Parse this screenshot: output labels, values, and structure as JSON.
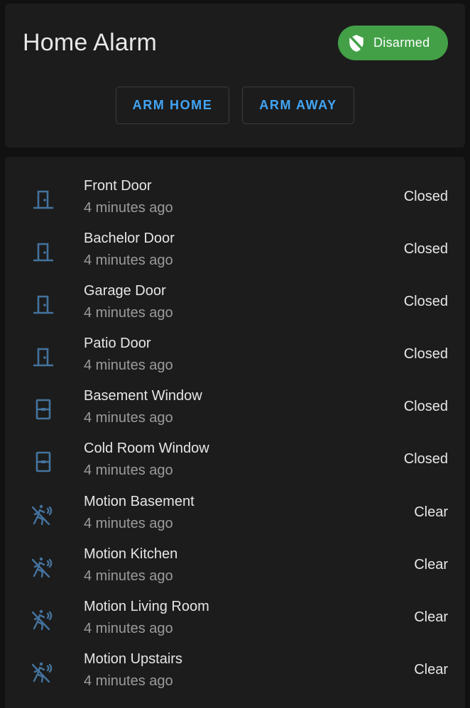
{
  "alarm": {
    "title": "Home Alarm",
    "status_label": "Disarmed",
    "status_icon": "shield-off-icon",
    "status_color": "#43a047",
    "arm_home_label": "ARM HOME",
    "arm_away_label": "ARM AWAY",
    "accent_color": "#42a5f5"
  },
  "entities": [
    {
      "name": "Front Door",
      "time": "4 minutes ago",
      "state": "Closed",
      "icon": "door-closed-icon"
    },
    {
      "name": "Bachelor Door",
      "time": "4 minutes ago",
      "state": "Closed",
      "icon": "door-closed-icon"
    },
    {
      "name": "Garage Door",
      "time": "4 minutes ago",
      "state": "Closed",
      "icon": "door-closed-icon"
    },
    {
      "name": "Patio Door",
      "time": "4 minutes ago",
      "state": "Closed",
      "icon": "door-closed-icon"
    },
    {
      "name": "Basement Window",
      "time": "4 minutes ago",
      "state": "Closed",
      "icon": "window-closed-icon"
    },
    {
      "name": "Cold Room Window",
      "time": "4 minutes ago",
      "state": "Closed",
      "icon": "window-closed-icon"
    },
    {
      "name": "Motion Basement",
      "time": "4 minutes ago",
      "state": "Clear",
      "icon": "motion-sensor-off-icon"
    },
    {
      "name": "Motion Kitchen",
      "time": "4 minutes ago",
      "state": "Clear",
      "icon": "motion-sensor-off-icon"
    },
    {
      "name": "Motion Living Room",
      "time": "4 minutes ago",
      "state": "Clear",
      "icon": "motion-sensor-off-icon"
    },
    {
      "name": "Motion Upstairs",
      "time": "4 minutes ago",
      "state": "Clear",
      "icon": "motion-sensor-off-icon"
    }
  ],
  "icon_color": "#44739e"
}
